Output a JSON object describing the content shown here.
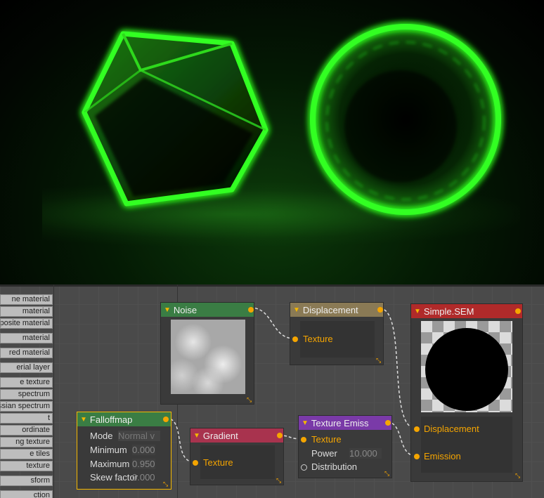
{
  "sidebar": {
    "items": [
      "ne material",
      "material",
      "posite material",
      "material",
      "red material",
      "erial layer",
      "e texture",
      "spectrum",
      "ssian spectrum",
      "t",
      "ordinate",
      "ng texture",
      "e tiles",
      "texture",
      "sform",
      "ction"
    ]
  },
  "nodes": {
    "noise": {
      "title": "Noise",
      "color": "#3a7d44"
    },
    "displacement": {
      "title": "Displacement",
      "color": "#8a7a55",
      "socket": "Texture"
    },
    "simple_sem": {
      "title": "Simple.SEM",
      "color": "#b02a2a",
      "socket_displacement": "Displacement",
      "socket_emission": "Emission"
    },
    "falloffmap": {
      "title": "Falloffmap",
      "color": "#3a7d44",
      "mode_label": "Mode",
      "mode_value": "Normal v",
      "minimum_label": "Minimum",
      "minimum_value": "0.000",
      "maximum_label": "Maximum",
      "maximum_value": "0.950",
      "skew_label": "Skew factor",
      "skew_value": "0.000"
    },
    "gradient": {
      "title": "Gradient",
      "color": "#a8334e",
      "socket": "Texture"
    },
    "texture_emiss": {
      "title": "Texture Emiss",
      "color": "#7a3aa8",
      "socket_texture": "Texture",
      "power_label": "Power",
      "power_value": "10.000",
      "distribution_label": "Distribution"
    }
  },
  "colors": {
    "accent": "#f5a500",
    "glow": "#2bff1a"
  }
}
